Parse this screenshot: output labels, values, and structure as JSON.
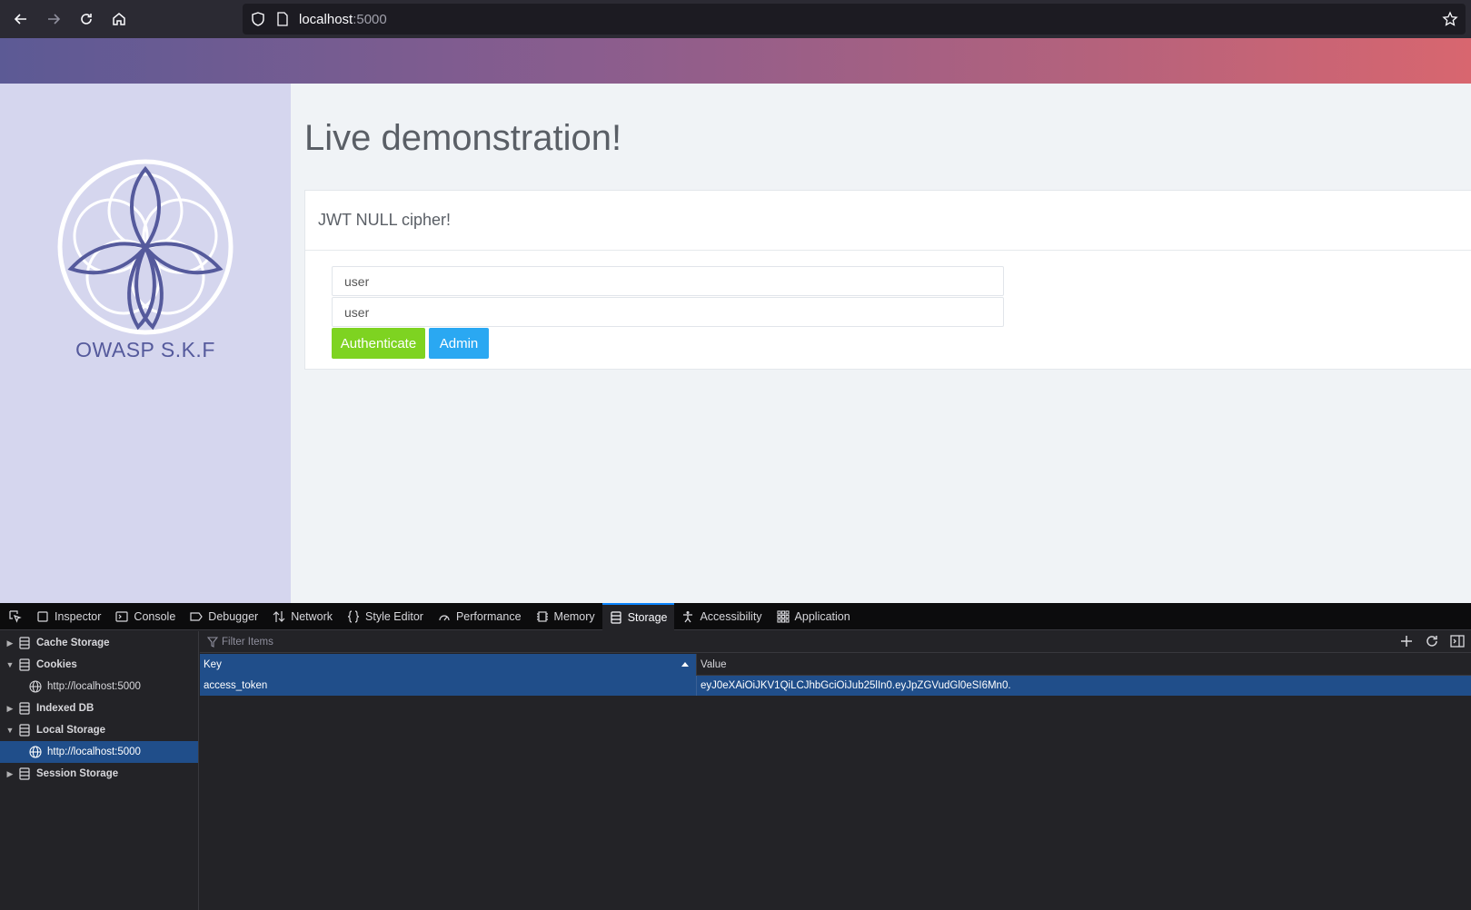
{
  "browser": {
    "url_host": "localhost",
    "url_port": ":5000",
    "icons": [
      "back-icon",
      "forward-icon",
      "reload-icon",
      "home-icon",
      "shield-icon",
      "page-icon",
      "star-icon"
    ]
  },
  "sidebar": {
    "logo_text": "OWASP S.K.F",
    "logo_color": "#555a9c"
  },
  "main": {
    "title": "Live demonstration!",
    "panel_heading": "JWT NULL cipher!",
    "username_value": "user",
    "password_value": "user",
    "authenticate_label": "Authenticate",
    "admin_label": "Admin",
    "authenticate_color": "#7ed321",
    "admin_color": "#2aa8f2"
  },
  "devtools": {
    "tabs": [
      {
        "label": "Inspector",
        "icon": "inspector-icon"
      },
      {
        "label": "Console",
        "icon": "console-icon"
      },
      {
        "label": "Debugger",
        "icon": "debugger-icon"
      },
      {
        "label": "Network",
        "icon": "network-icon"
      },
      {
        "label": "Style Editor",
        "icon": "style-editor-icon"
      },
      {
        "label": "Performance",
        "icon": "performance-icon"
      },
      {
        "label": "Memory",
        "icon": "memory-icon"
      },
      {
        "label": "Storage",
        "icon": "storage-icon",
        "active": true
      },
      {
        "label": "Accessibility",
        "icon": "accessibility-icon"
      },
      {
        "label": "Application",
        "icon": "application-icon"
      }
    ],
    "tree": [
      {
        "label": "Cache Storage"
      },
      {
        "label": "Cookies"
      },
      {
        "label": "http://localhost:5000"
      },
      {
        "label": "Indexed DB"
      },
      {
        "label": "Local Storage"
      },
      {
        "label": "http://localhost:5000"
      },
      {
        "label": "Session Storage"
      }
    ],
    "filter_placeholder": "Filter Items",
    "columns": {
      "key": "Key",
      "value": "Value"
    },
    "rows": [
      {
        "key": "access_token",
        "value": "eyJ0eXAiOiJKV1QiLCJhbGciOiJub25lIn0.eyJpZGVudGl0eSI6Mn0."
      }
    ]
  }
}
